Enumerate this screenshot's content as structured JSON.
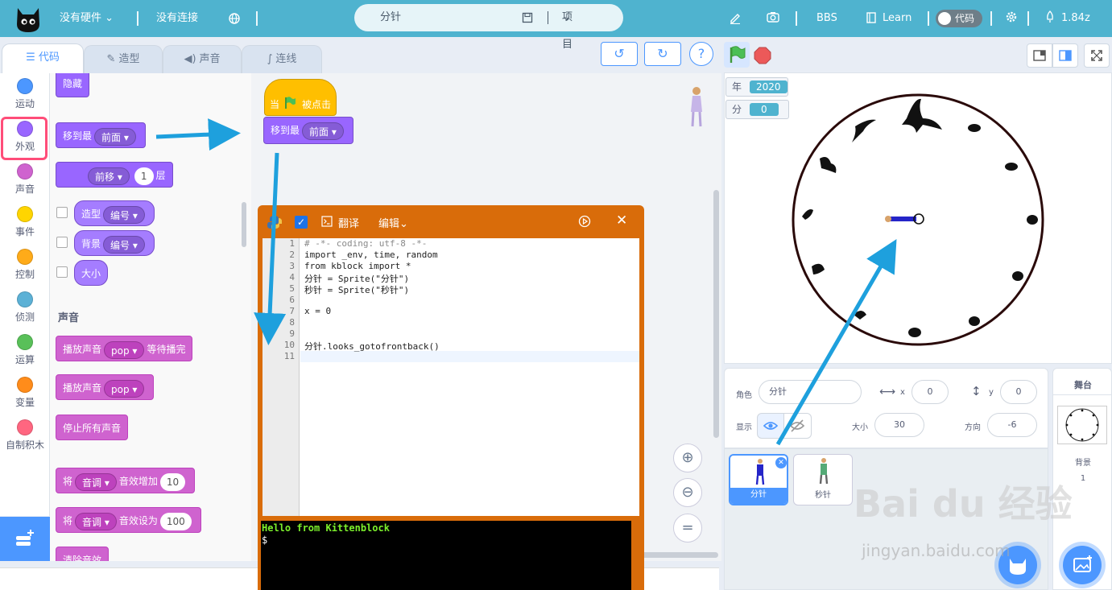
{
  "topbar": {
    "hardware": "没有硬件",
    "connection": "没有连接",
    "sprite_field": "分针",
    "project_menu": "项目",
    "bbs": "BBS",
    "learn": "Learn",
    "code_toggle": "代码",
    "fps": "1.84z"
  },
  "tabs": {
    "code": "代码",
    "costume": "造型",
    "sound": "声音",
    "wire": "连线"
  },
  "categories": [
    {
      "label": "运动",
      "color": "#4c97ff"
    },
    {
      "label": "外观",
      "color": "#9966ff"
    },
    {
      "label": "声音",
      "color": "#cf63cf"
    },
    {
      "label": "事件",
      "color": "#ffd500"
    },
    {
      "label": "控制",
      "color": "#ffab19"
    },
    {
      "label": "侦测",
      "color": "#5cb1d6"
    },
    {
      "label": "运算",
      "color": "#59c059"
    },
    {
      "label": "变量",
      "color": "#ff8c1a"
    },
    {
      "label": "自制积木",
      "color": "#ff6680"
    }
  ],
  "palette": {
    "hide": "隐藏",
    "goto_front": "移到最",
    "front_opt": "前面",
    "move_forward_opt": "前移",
    "layers_value": "1",
    "layers_label": "层",
    "costume": "造型",
    "costume_opt": "编号",
    "backdrop": "背景",
    "backdrop_opt": "编号",
    "size": "大小",
    "sound_heading": "声音",
    "play_until_done": "播放声音",
    "sound_opt": "pop",
    "until_done_label": "等待播完",
    "play_sound": "播放声音",
    "sound_opt2": "pop",
    "stop_all_sounds": "停止所有声音",
    "set_prefix": "将",
    "pitch_opt": "音调",
    "effect_change": "音效增加",
    "effect_change_val": "10",
    "set_prefix2": "将",
    "pitch_opt2": "音调",
    "effect_set": "音效设为",
    "effect_set_val": "100",
    "clear_effects": "清除音效"
  },
  "script": {
    "hat_when": "当",
    "hat_clicked": "被点击",
    "goto_front": "移到最",
    "front_opt": "前面"
  },
  "pywin": {
    "translate": "翻译",
    "edit": "编辑",
    "code_lines": [
      "# -*- coding: utf-8 -*-",
      "import _env, time, random",
      "from kblock import *",
      "分针 = Sprite(\"分针\")",
      "秒针 = Sprite(\"秒针\")",
      "",
      "x = 0",
      "",
      "",
      "分针.looks_gotofrontback()",
      ""
    ],
    "terminal_line1": "Hello from Kittenblock",
    "terminal_line2": "$"
  },
  "monitors": {
    "year_label": "年",
    "year_value": "2020",
    "min_label": "分",
    "min_value": "0"
  },
  "sprite_info": {
    "sprite_label": "角色",
    "sprite_name": "分针",
    "x_label": "x",
    "x_value": "0",
    "y_label": "y",
    "y_value": "0",
    "show_label": "显示",
    "size_label": "大小",
    "size_value": "30",
    "direction_label": "方向",
    "direction_value": "-6"
  },
  "sprites": [
    {
      "name": "分针"
    },
    {
      "name": "秒针"
    }
  ],
  "stage_panel": {
    "title": "舞台",
    "backdrop_label": "背景",
    "backdrop_count": "1"
  },
  "watermark": {
    "brand": "Bai du 经验",
    "url": "jingyan.baidu.com"
  }
}
